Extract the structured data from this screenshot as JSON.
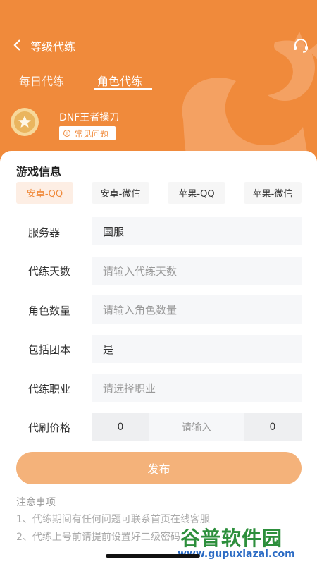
{
  "nav": {
    "title": "等级代练"
  },
  "tabs": [
    {
      "label": "每日代练"
    },
    {
      "label": "角色代练"
    }
  ],
  "character": {
    "name": "DNF王者操刀",
    "faq_label": "常见问题"
  },
  "section_title": "游戏信息",
  "platforms": [
    {
      "label": "安卓-QQ",
      "selected": true
    },
    {
      "label": "安卓-微信",
      "selected": false
    },
    {
      "label": "苹果-QQ",
      "selected": false
    },
    {
      "label": "苹果-微信",
      "selected": false
    }
  ],
  "form": {
    "server": {
      "label": "服务器",
      "value": "国服"
    },
    "days": {
      "label": "代练天数",
      "placeholder": "请输入代练天数"
    },
    "role_count": {
      "label": "角色数量",
      "placeholder": "请输入角色数量"
    },
    "include_raid": {
      "label": "包括团本",
      "value": "是"
    },
    "job": {
      "label": "代练职业",
      "placeholder": "请选择职业"
    },
    "price": {
      "label": "代刷价格",
      "left_value": "0",
      "placeholder": "请输入",
      "right_value": "0"
    }
  },
  "publish_label": "发布",
  "notice": {
    "title": "注意事项",
    "lines": [
      "1、代练期间有任何问题可联系首页在线客服",
      "2、代练上号前请提前设置好二级密码"
    ]
  },
  "watermark": {
    "title": "谷普软件园",
    "url": "www.gupuxlazal.com"
  },
  "colors": {
    "brand": "#f08a3b",
    "publish": "#f4b27a",
    "field_bg": "#f6f7f9"
  },
  "icons": [
    "back-arrow-icon",
    "headset-icon",
    "medal-icon",
    "info-icon"
  ]
}
